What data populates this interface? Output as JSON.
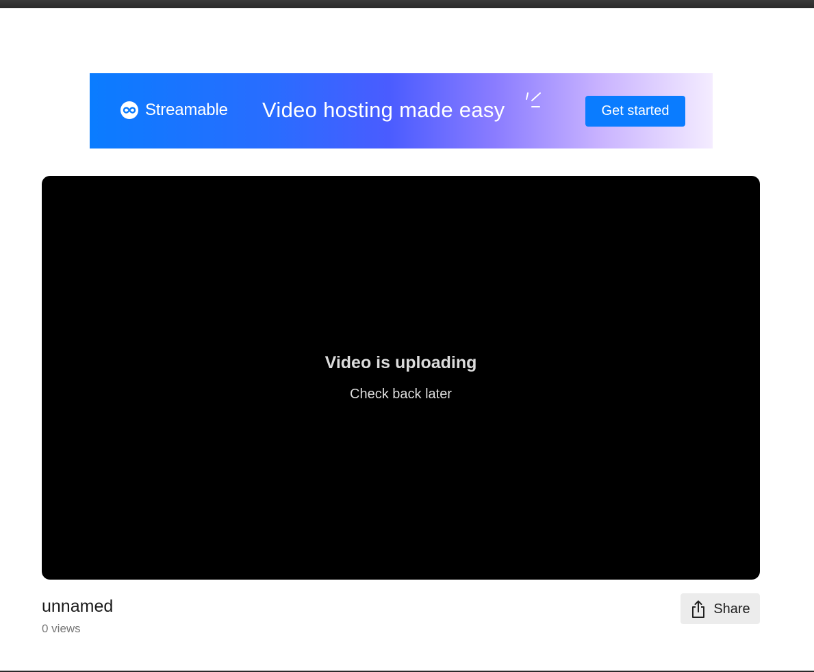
{
  "banner": {
    "brand_name": "Streamable",
    "tagline": "Video hosting made easy",
    "cta_label": "Get started"
  },
  "player": {
    "status_title": "Video is uploading",
    "status_subtitle": "Check back later"
  },
  "video": {
    "title": "unnamed",
    "views": "0 views"
  },
  "actions": {
    "share_label": "Share"
  },
  "colors": {
    "brand_blue": "#0a7cff",
    "player_bg": "#000000",
    "share_bg": "#ececec"
  },
  "icons": {
    "brand_logo": "streamable-infinity-logo-icon",
    "sparkle": "sparkle-icon",
    "share": "share-upload-icon"
  }
}
